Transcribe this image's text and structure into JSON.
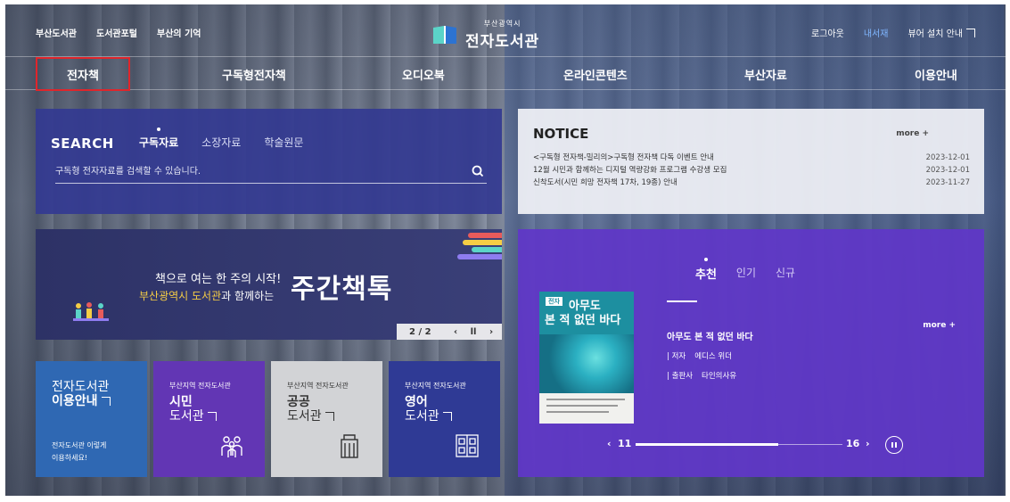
{
  "top_links": [
    "부산도서관",
    "도서관포털",
    "부산의 기억"
  ],
  "logo": {
    "sub": "부산광역시",
    "main": "전자도서관"
  },
  "user_links": {
    "login": "로그아웃",
    "mylib": "내서재",
    "viewer": "뷰어 설치 안내"
  },
  "nav": {
    "items": [
      "전자책",
      "구독형전자책",
      "오디오북",
      "온라인콘텐츠",
      "부산자료",
      "이용안내"
    ],
    "selected_index": 0
  },
  "search": {
    "title": "SEARCH",
    "tabs": [
      "구독자료",
      "소장자료",
      "학술원문"
    ],
    "active_tab": 0,
    "placeholder": "구독형 전자자료를 검색할 수 있습니다."
  },
  "notice": {
    "title": "NOTICE",
    "more": "more +",
    "items": [
      {
        "title": "<구독형 전자책-밀리의>구독형 전자책 다독 이벤트 안내",
        "date": "2023-12-01"
      },
      {
        "title": "12월 시민과 함께하는 디지털 역량강화 프로그램 수강생 모집",
        "date": "2023-12-01"
      },
      {
        "title": "신착도서(시민 희망 전자책 17차, 19종) 안내",
        "date": "2023-11-27"
      }
    ]
  },
  "banner": {
    "line1": "책으로 여는 한 주의 시작!",
    "line2_highlight": "부산광역시 도서관",
    "line2_rest": "과 함께하는",
    "big": "주간책톡",
    "pager": "2 / 2"
  },
  "tiles": {
    "guide": {
      "line1": "전자도서관",
      "line2": "이용안내",
      "note1": "전자도서관 이렇게",
      "note2": "이용하세요!"
    },
    "citizen": {
      "small": "부산지역 전자도서관",
      "big": "시민",
      "light": "도서관"
    },
    "public": {
      "small": "부산지역 전자도서관",
      "big": "공공",
      "light": "도서관"
    },
    "english": {
      "small": "부산지역 전자도서관",
      "big": "영어",
      "light": "도서관"
    }
  },
  "recommend": {
    "tabs": [
      "추천",
      "인기",
      "신규"
    ],
    "active_tab": 0,
    "more": "more +",
    "book": {
      "cover_badge": "전자",
      "cover_line1": "아무도",
      "cover_line2": "본 적 없던 바다",
      "title": "아무도 본 적 없던 바다",
      "author_label": "저자",
      "author": "에디스 위더",
      "publisher_label": "출판사",
      "publisher": "타인의사유"
    },
    "pager": {
      "current": "11",
      "total": "16",
      "progress": 0.6875
    }
  },
  "colors": {
    "nav_selected_outline": "#e0252b",
    "search_bg": "#333a91",
    "rec_bg": "#6037c8",
    "banner_yellow": "#f5cd45"
  }
}
